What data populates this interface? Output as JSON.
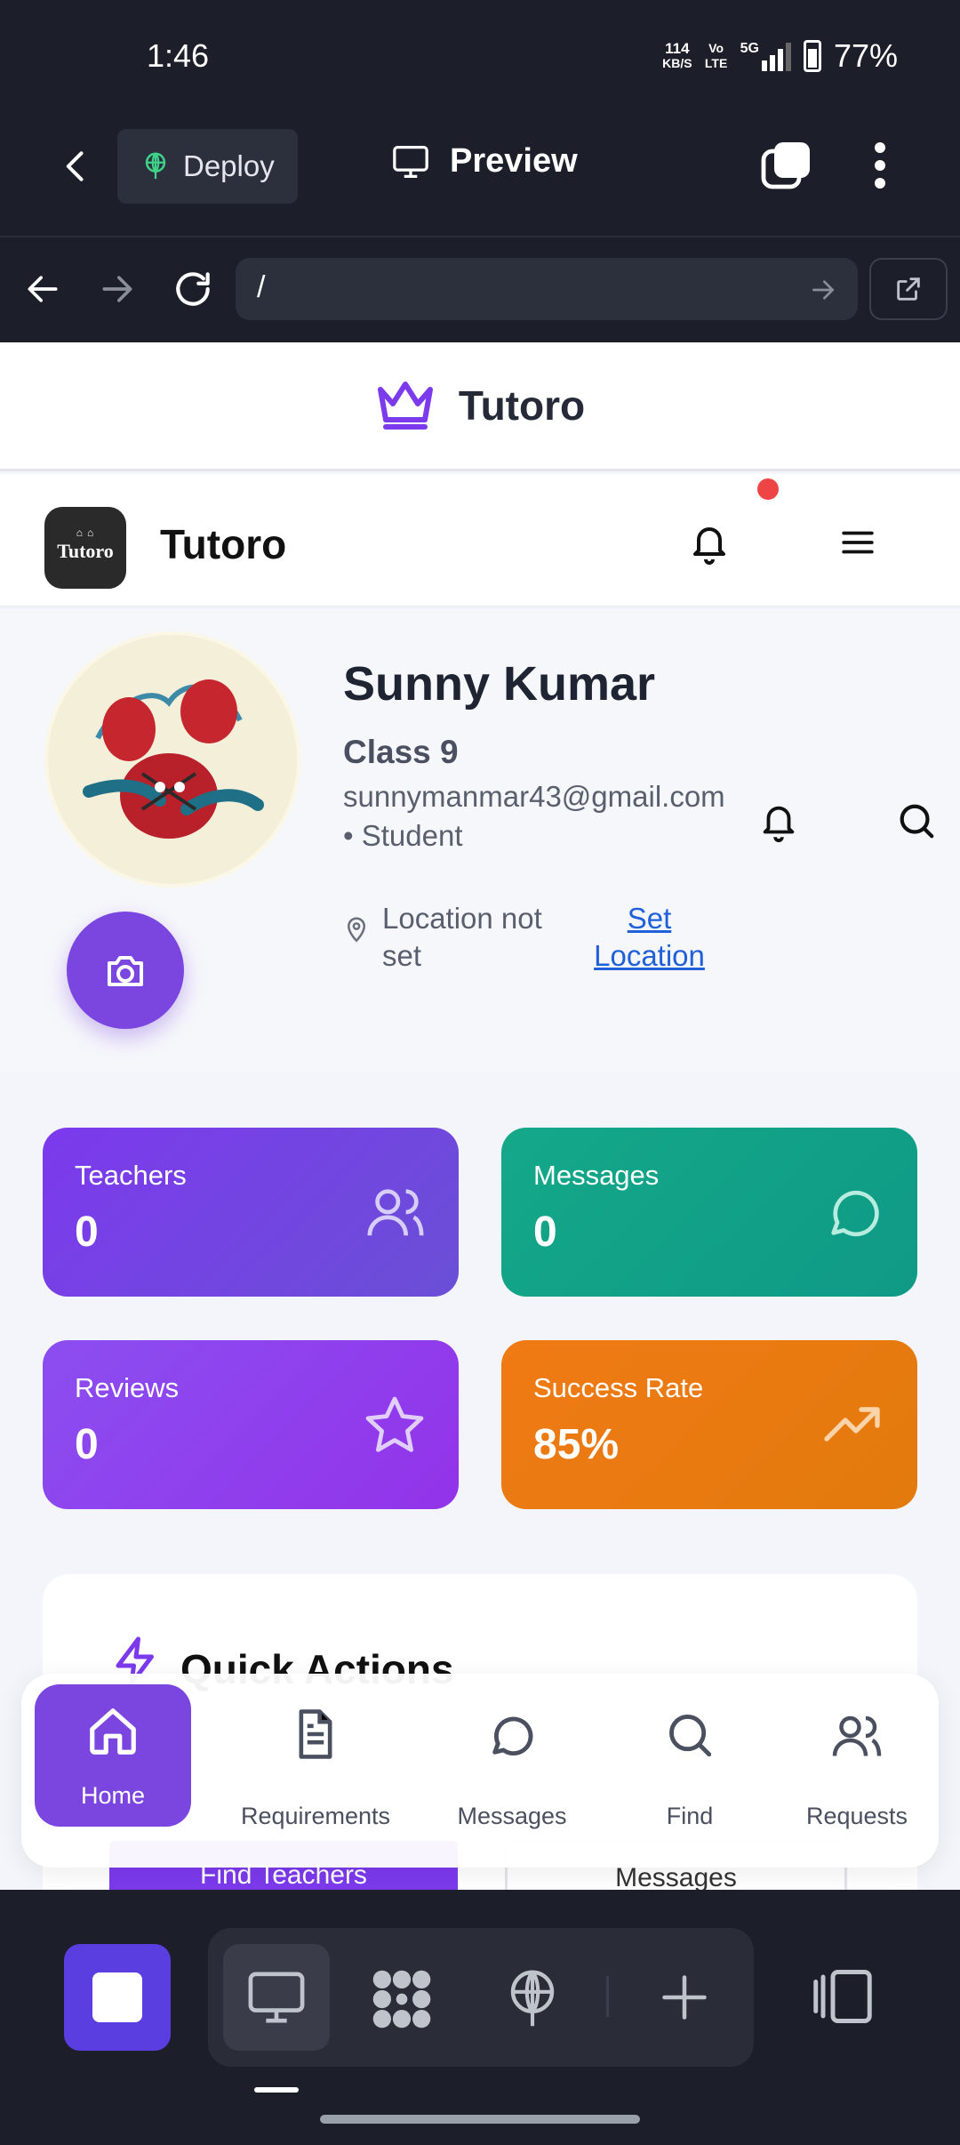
{
  "status_bar": {
    "time": "1:46",
    "speed_value": "114",
    "speed_unit": "KB/S",
    "volte": "Vo LTE",
    "network": "5G",
    "battery": "77%"
  },
  "toolbar": {
    "deploy_label": "Deploy",
    "preview_label": "Preview"
  },
  "url_bar": {
    "value": "/"
  },
  "site_header": {
    "brand": "Tutoro"
  },
  "navbar": {
    "title": "Tutoro",
    "logo_text": "Tutoro"
  },
  "profile": {
    "name": "Sunny Kumar",
    "class": "Class 9",
    "email": "sunnymanmar43@gmail.com",
    "role": "• Student",
    "location_line1": "Location not",
    "location_line2": "set",
    "set_location_line1": "Set",
    "set_location_line2": "Location"
  },
  "stats": [
    {
      "label": "Teachers",
      "value": "0",
      "icon": "users-icon",
      "color": "#7b45e0"
    },
    {
      "label": "Messages",
      "value": "0",
      "icon": "message-icon",
      "color": "#14a889"
    },
    {
      "label": "Reviews",
      "value": "0",
      "icon": "star-icon",
      "color": "#9246ea"
    },
    {
      "label": "Success Rate",
      "value": "85%",
      "icon": "trending-up-icon",
      "color": "#ec7716"
    }
  ],
  "quick_actions": {
    "title": "Quick Actions",
    "primary_button": "Find Teachers",
    "secondary_button": "Messages"
  },
  "bottom_nav": [
    {
      "label": "Home",
      "icon": "home-icon",
      "active": true
    },
    {
      "label": "Requirements",
      "icon": "document-icon",
      "active": false
    },
    {
      "label": "Messages",
      "icon": "message-icon",
      "active": false
    },
    {
      "label": "Find",
      "icon": "search-icon",
      "active": false
    },
    {
      "label": "Requests",
      "icon": "users-icon",
      "active": false
    }
  ]
}
